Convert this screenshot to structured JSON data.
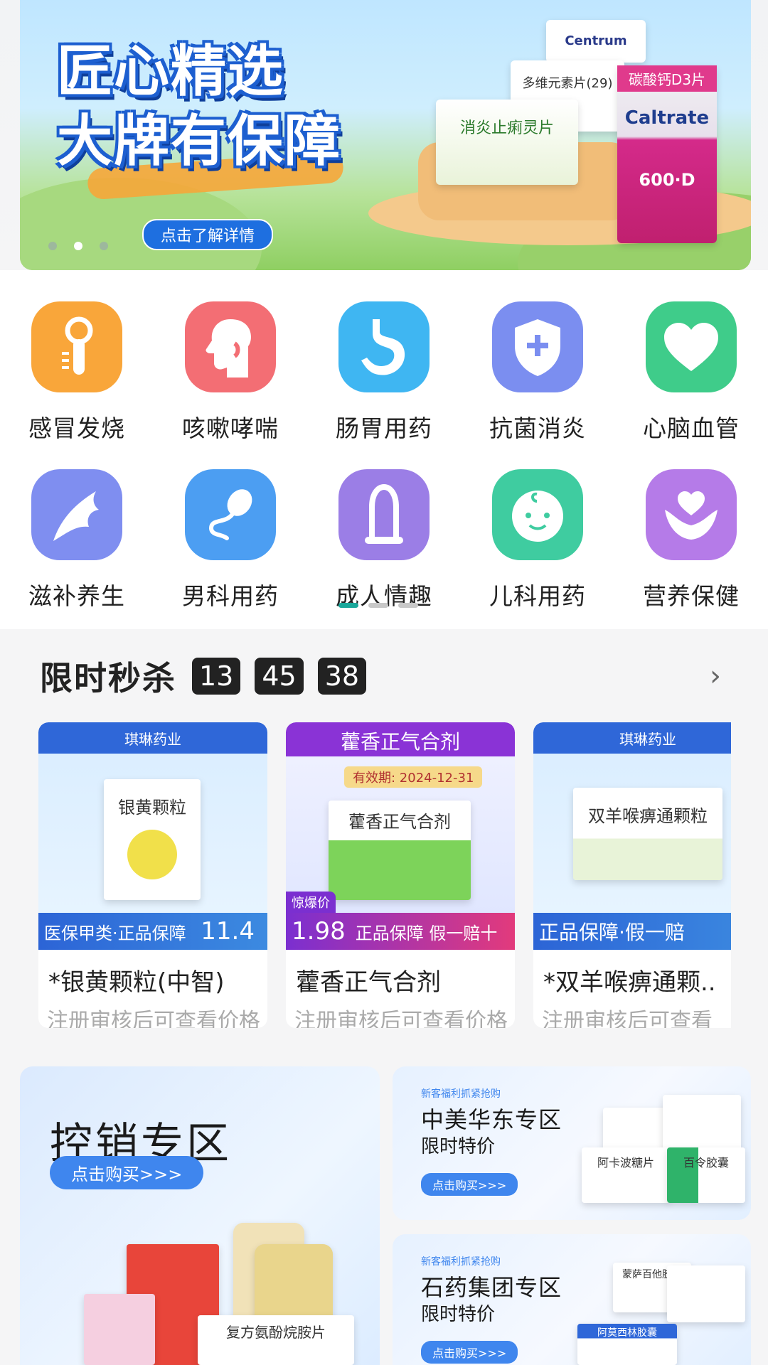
{
  "banner": {
    "title_line1": "匠心精选",
    "title_line2": "大牌有保障",
    "button": "点击了解详情",
    "box_centrum": "Centrum",
    "box_multivitamin": "多维元素片(29)",
    "box_caltrate_title": "碳酸钙D3片",
    "box_caltrate_brand": "Caltrate",
    "box_caltrate_dose": "600·D",
    "box_xiaoyan": "消炎止痢灵片"
  },
  "categories": [
    {
      "label": "感冒发烧",
      "icon": "thermometer-icon",
      "color": "#f9a63a"
    },
    {
      "label": "咳嗽哮喘",
      "icon": "throat-icon",
      "color": "#f36e74"
    },
    {
      "label": "肠胃用药",
      "icon": "stomach-icon",
      "color": "#3fb6f2"
    },
    {
      "label": "抗菌消炎",
      "icon": "shield-plus-icon",
      "color": "#7b8ef0"
    },
    {
      "label": "心脑血管",
      "icon": "heart-icon",
      "color": "#3fcc8a"
    },
    {
      "label": "滋补养生",
      "icon": "ginseng-icon",
      "color": "#7f8ef0"
    },
    {
      "label": "男科用药",
      "icon": "sperm-icon",
      "color": "#4c9ef2"
    },
    {
      "label": "成人情趣",
      "icon": "condom-icon",
      "color": "#9b7ee6"
    },
    {
      "label": "儿科用药",
      "icon": "baby-face-icon",
      "color": "#3fcca0"
    },
    {
      "label": "营养保健",
      "icon": "hands-heart-icon",
      "color": "#b57be8"
    }
  ],
  "flash": {
    "title": "限时秒杀",
    "hours": "13",
    "minutes": "45",
    "seconds": "38"
  },
  "products": [
    {
      "name": "*银黄颗粒(中智)",
      "price": "注册审核后可查看价格",
      "band": "医保甲类·正品保障",
      "band_price": "11.4",
      "box": "银黄颗粒",
      "header": "琪琳药业"
    },
    {
      "name": "藿香正气合剂",
      "price": "注册审核后可查看价格",
      "band": "正品保障 假一赔十",
      "band_price": "1.98",
      "box": "藿香正气合剂",
      "header": "藿香正气合剂",
      "sub": "有效期: 2024-12-31",
      "badge": "惊爆价"
    },
    {
      "name": "*双羊喉痹通颗..",
      "price": "注册审核后可查看",
      "band": "正品保障·假一赔",
      "box": "双羊喉痹通颗粒",
      "header": "琪琳药业"
    }
  ],
  "promo": {
    "big_title": "控销专区",
    "big_button": "点击购买>>>",
    "big_box": "复方氨酚烷胺片",
    "small": [
      {
        "tag": "新客福利抓紧抢购",
        "title": "中美华东专区",
        "sub": "限时特价",
        "button": "点击购买>>>",
        "box1": "阿卡波糖片",
        "box2": "百令胶囊"
      },
      {
        "tag": "新客福利抓紧抢购",
        "title": "石药集团专区",
        "sub": "限时特价",
        "button": "点击购买>>>",
        "box1": "蒙萨百他胶囊",
        "box2": "阿莫西林胶囊"
      }
    ]
  }
}
